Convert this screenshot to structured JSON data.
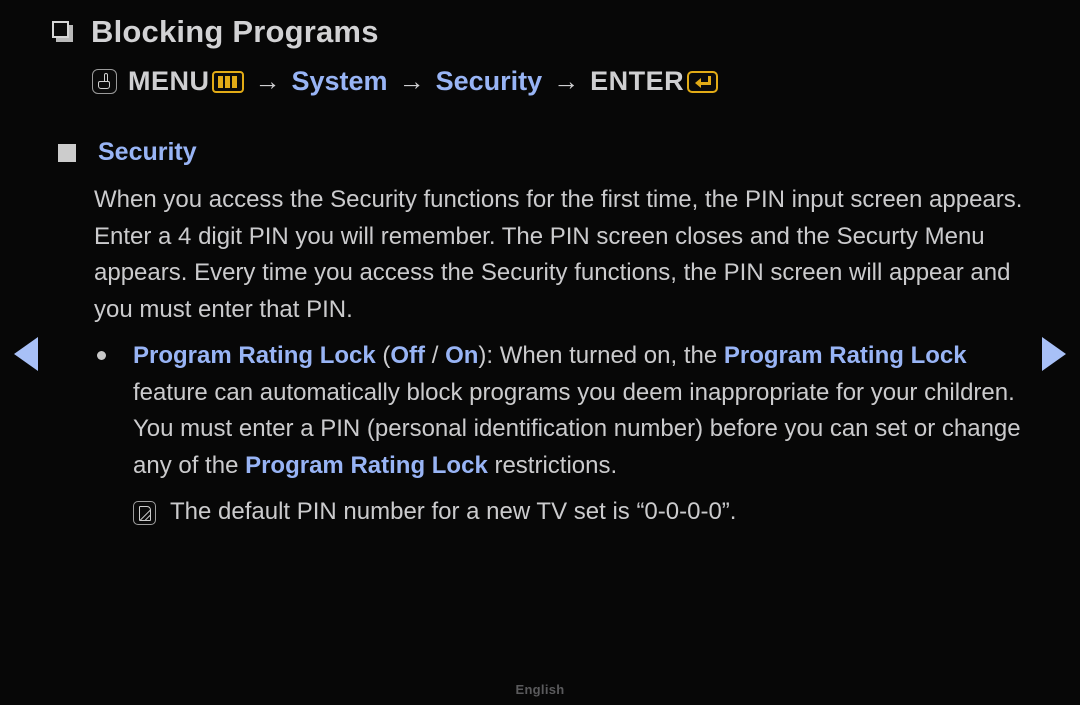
{
  "page": {
    "title": "Blocking Programs",
    "title_bullet_icon": "square-outline-bullet-icon"
  },
  "menu_path": {
    "hand_icon": "hand-press-icon",
    "menu_label": "MENU",
    "menu_box_icon": "menu-bars-icon",
    "arrow1": "→",
    "system_label": "System",
    "arrow2": "→",
    "security_label": "Security",
    "arrow3": "→",
    "enter_label": "ENTER",
    "enter_icon": "enter-return-icon"
  },
  "section": {
    "bullet_icon": "filled-square-bullet-icon",
    "heading": "Security",
    "paragraph": "When you access the Security functions for the first time, the PIN input screen appears. Enter a 4 digit PIN you will remember. The PIN screen closes and the Securty Menu appears. Every time you access the Security functions, the PIN screen will appear and you must enter that PIN."
  },
  "bullet_item": {
    "bullet_icon": "round-dot-bullet-icon",
    "term": "Program Rating Lock",
    "paren_open": " (",
    "option_off": "Off",
    "option_sep": " / ",
    "option_on": "On",
    "paren_close": "): ",
    "text_1": "When turned on, the ",
    "term_2": "Program Rating Lock",
    "text_2": " feature can automatically block programs you deem inappropriate for your children. You must enter a PIN (personal identification number) before you can set or change any of the ",
    "term_3": "Program Rating Lock",
    "text_3": " restrictions."
  },
  "note": {
    "icon": "note-pencil-icon",
    "text": "The default PIN number for a new TV set is “0-0-0-0”."
  },
  "navigation": {
    "prev_icon": "triangle-left-icon",
    "next_icon": "triangle-right-icon"
  },
  "footer": {
    "language": "English"
  },
  "colors": {
    "background": "#070707",
    "body_text": "#cbcbcd",
    "accent_blue": "#98b4f5",
    "accent_gold": "#e2ab16",
    "footer_text": "#5a5a5c"
  }
}
